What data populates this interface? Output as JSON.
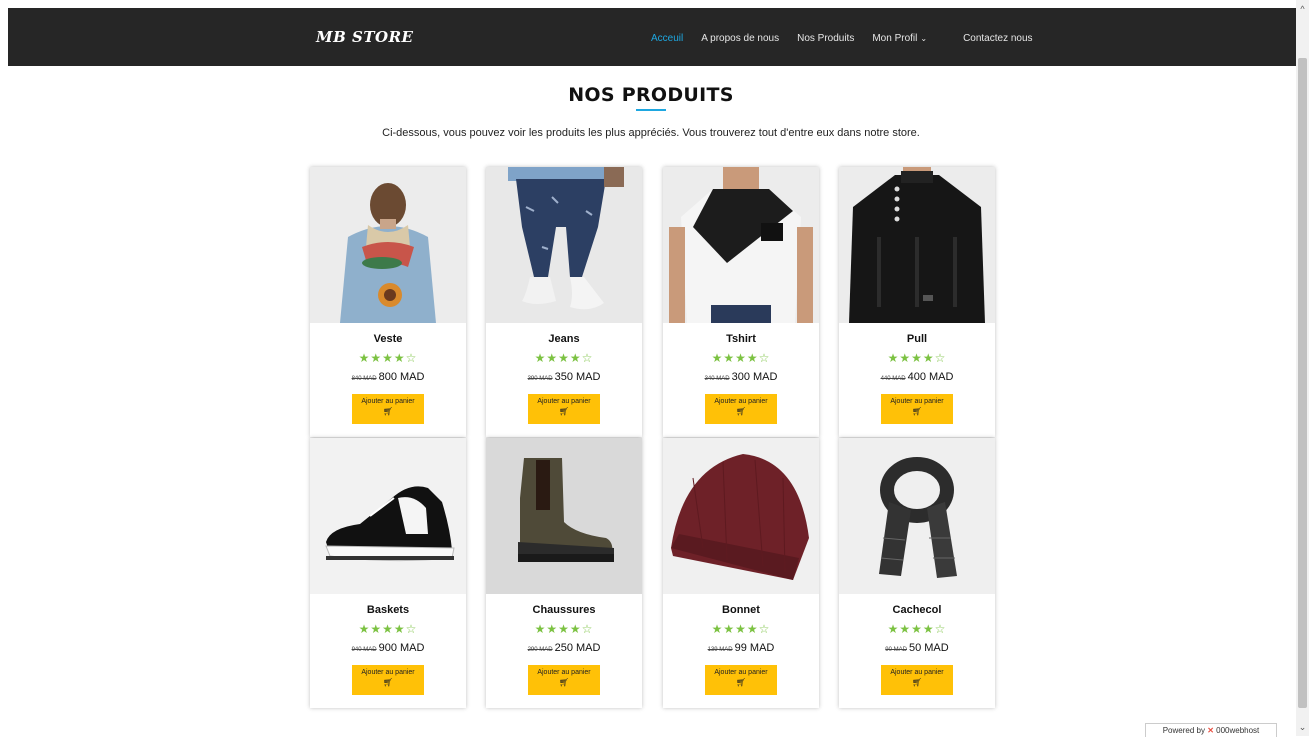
{
  "nav": {
    "logo": "MB STORE",
    "links": [
      "Acceuil",
      "A propos de nous",
      "Nos Produits",
      "Mon Profil",
      "Contactez nous"
    ],
    "active_color": "#1ea7e0"
  },
  "section": {
    "title": "NOS PRODUITS",
    "subtitle": "Ci-dessous, vous pouvez voir les produits les plus appréciés. Vous trouverez tout d'entre eux dans notre store."
  },
  "products": [
    {
      "name": "Veste",
      "stars": "★★★★☆",
      "old_price": "840 MAD",
      "price": "800 MAD",
      "cta": "Ajouter au panier",
      "image": "denim-jacket"
    },
    {
      "name": "Jeans",
      "stars": "★★★★☆",
      "old_price": "390 MAD",
      "price": "350 MAD",
      "cta": "Ajouter au panier",
      "image": "jeans"
    },
    {
      "name": "Tshirt",
      "stars": "★★★★☆",
      "old_price": "340 MAD",
      "price": "300 MAD",
      "cta": "Ajouter au panier",
      "image": "tshirt"
    },
    {
      "name": "Pull",
      "stars": "★★★★☆",
      "old_price": "440 MAD",
      "price": "400 MAD",
      "cta": "Ajouter au panier",
      "image": "sweater"
    },
    {
      "name": "Baskets",
      "stars": "★★★★☆",
      "old_price": "940 MAD",
      "price": "900 MAD",
      "cta": "Ajouter au panier",
      "image": "sneaker"
    },
    {
      "name": "Chaussures",
      "stars": "★★★★☆",
      "old_price": "290 MAD",
      "price": "250 MAD",
      "cta": "Ajouter au panier",
      "image": "boot"
    },
    {
      "name": "Bonnet",
      "stars": "★★★★☆",
      "old_price": "139 MAD",
      "price": "99 MAD",
      "cta": "Ajouter au panier",
      "image": "beanie"
    },
    {
      "name": "Cachecol",
      "stars": "★★★★☆",
      "old_price": "90 MAD",
      "price": "50 MAD",
      "cta": "Ajouter au panier",
      "image": "scarf"
    }
  ],
  "footer": {
    "powered_by": "Powered by",
    "host": "000webhost"
  },
  "colors": {
    "navbar": "#262626",
    "star": "#7cc242",
    "button": "#ffc107"
  }
}
